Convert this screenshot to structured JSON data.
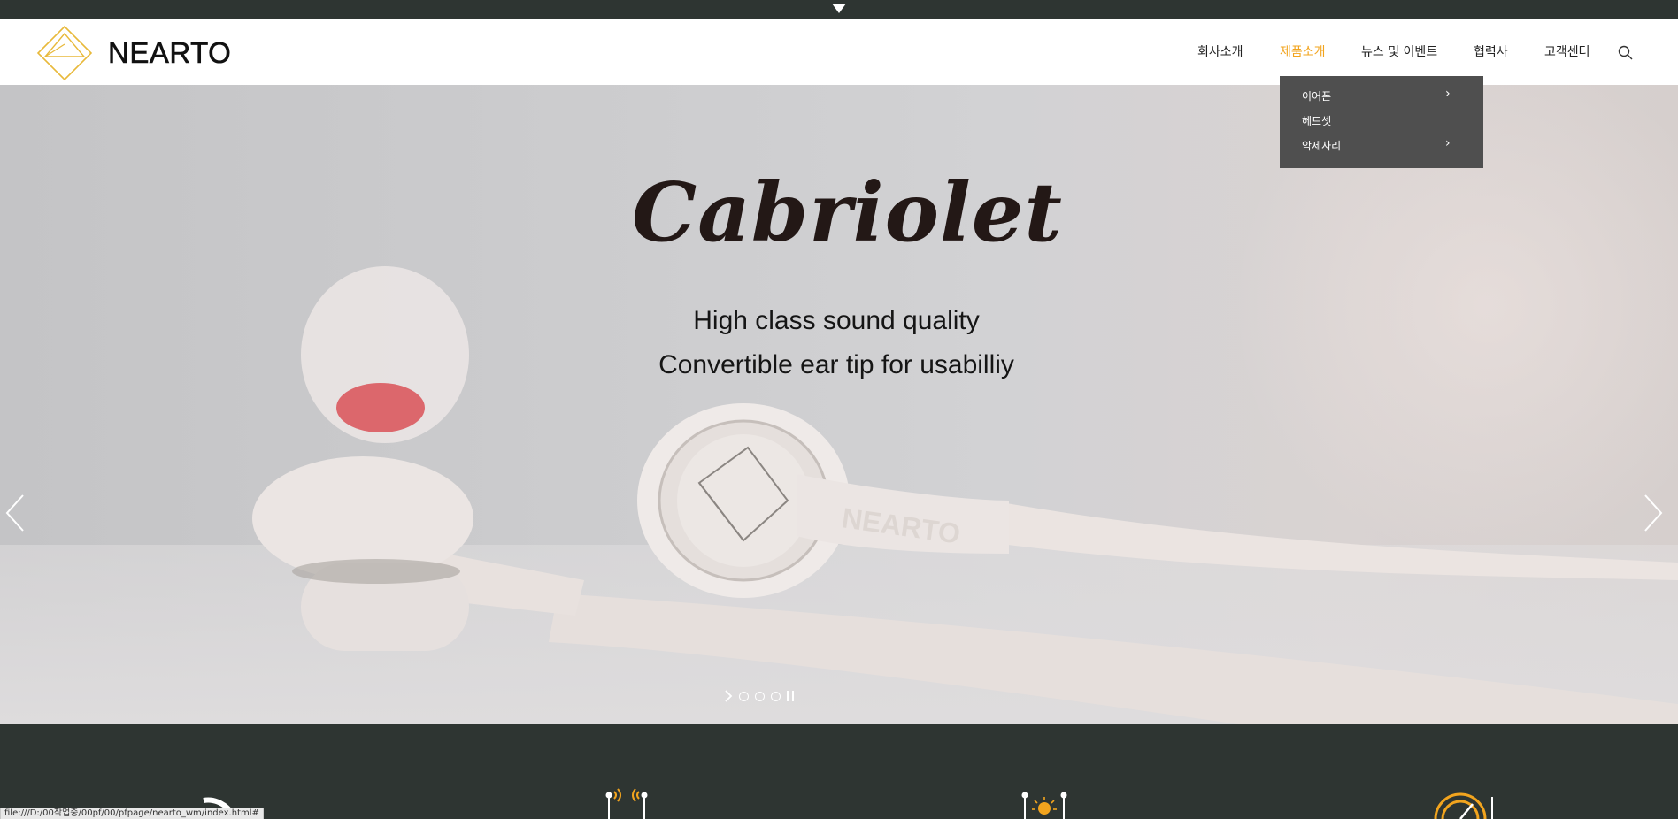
{
  "brand": {
    "name": "NEARTO"
  },
  "nav": {
    "items": [
      {
        "label": "회사소개",
        "active": false
      },
      {
        "label": "제품소개",
        "active": true
      },
      {
        "label": "뉴스 및 이벤트",
        "active": false
      },
      {
        "label": "협력사",
        "active": false
      },
      {
        "label": "고객센터",
        "active": false
      }
    ],
    "search_icon": "search-icon"
  },
  "dropdown": {
    "items": [
      {
        "label": "이어폰",
        "has_submenu": true
      },
      {
        "label": "헤드셋",
        "has_submenu": false
      },
      {
        "label": "악세사리",
        "has_submenu": true
      }
    ],
    "submenu_glyph": "›"
  },
  "hero": {
    "title": "Cabriolet",
    "line1": "High class sound quality",
    "line2": "Convertible ear tip for usabilliy",
    "prev_icon": "chevron-left-icon",
    "next_icon": "chevron-right-icon",
    "pager": {
      "slides": 3,
      "current": 0
    }
  },
  "statusbar": {
    "text": "file:///D:/00작업중/00pf/00/pfpage/nearto_wm/index.html#"
  },
  "colors": {
    "accent": "#f2a41e",
    "dark_band": "#2e3532",
    "dropdown_bg": "#4f4f4f"
  }
}
